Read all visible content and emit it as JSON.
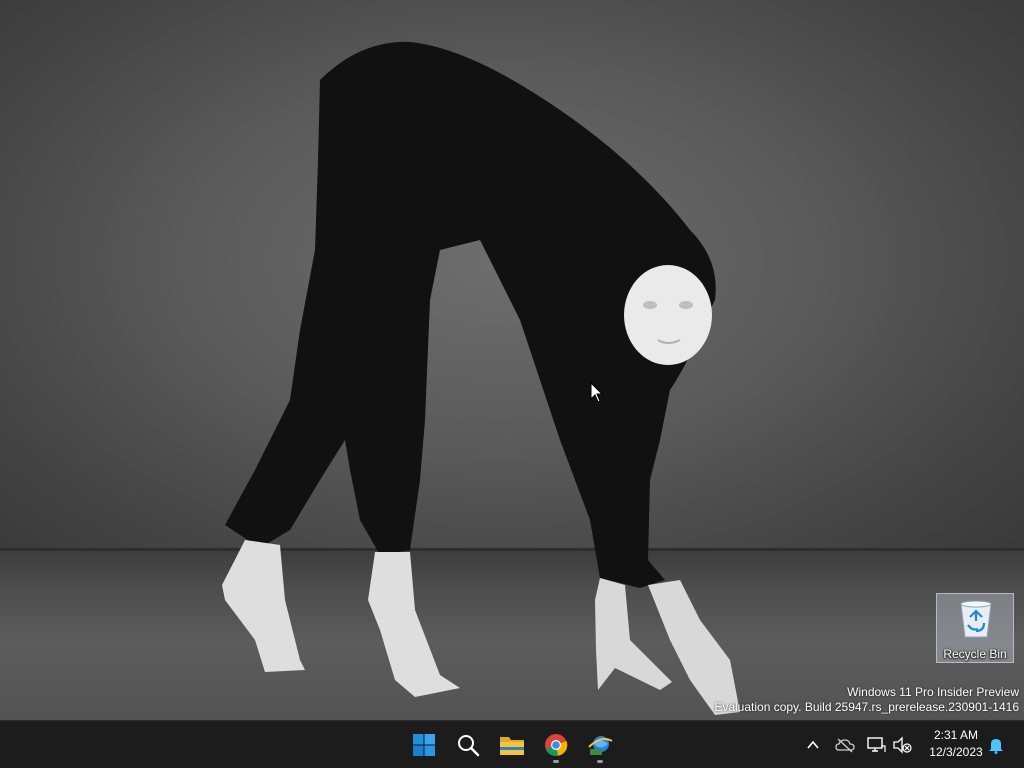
{
  "desktop": {
    "icons": [
      {
        "label": "Recycle Bin",
        "icon": "recycle-bin-icon"
      }
    ],
    "watermark": {
      "line1": "Windows 11 Pro Insider Preview",
      "line2": "Evaluation copy. Build 25947.rs_prerelease.230901-1416"
    }
  },
  "taskbar": {
    "apps": [
      {
        "name": "Start",
        "icon": "windows-start-icon",
        "running": false
      },
      {
        "name": "Search",
        "icon": "search-icon",
        "running": false
      },
      {
        "name": "File Explorer",
        "icon": "folder-icon",
        "running": false
      },
      {
        "name": "Google Chrome",
        "icon": "chrome-icon",
        "running": true
      },
      {
        "name": "Network app",
        "icon": "network-globe-icon",
        "running": true
      }
    ],
    "tray": {
      "icons": [
        "chevron-up-icon",
        "onedrive-offline-icon",
        "network-icon",
        "volume-muted-icon",
        "notification-bell-icon"
      ]
    },
    "clock": {
      "time": "2:31 AM",
      "date": "12/3/2023"
    }
  },
  "colors": {
    "taskbar_bg": "#1c1c1c",
    "start_blue": "#1f8fe0",
    "folder_yellow": "#f3c53a",
    "bell_blue": "#4cc2ff"
  }
}
